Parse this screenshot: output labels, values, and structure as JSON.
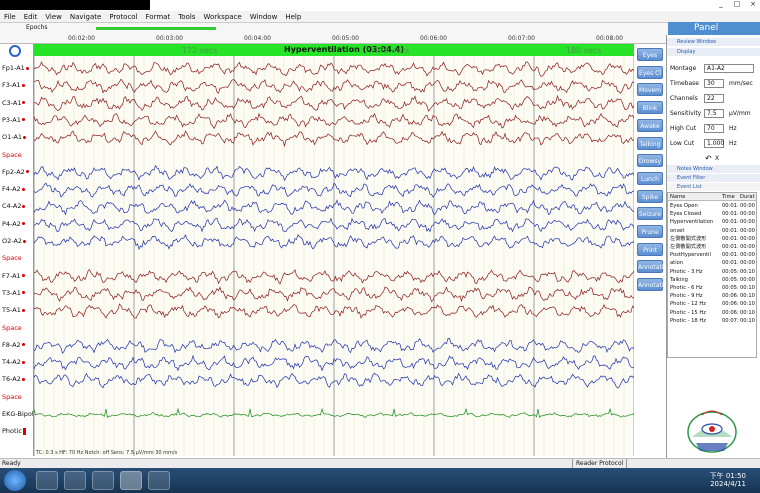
{
  "window": {
    "minimize": "_",
    "maximize": "□",
    "close": "×"
  },
  "menu": [
    "File",
    "Edit",
    "View",
    "Navigate",
    "Protocol",
    "Format",
    "Tools",
    "Workspace",
    "Window",
    "Help"
  ],
  "panel_tab": "Panel",
  "epochs_label": "Epochs",
  "timeline": [
    "00:02:00",
    "00:03:00",
    "00:04:00",
    "00:05:00",
    "00:06:00",
    "00:07:00",
    "00:08:00"
  ],
  "hv": {
    "title": "Hyperventilation (03:04.4)",
    "secs1": "172 secs",
    "secs2": "176 secs",
    "secs3": "180 secs"
  },
  "channels": [
    {
      "label": "Fp1-A1",
      "color": "#8b1a1a"
    },
    {
      "label": "F3-A1",
      "color": "#8b1a1a"
    },
    {
      "label": "C3-A1",
      "color": "#8b1a1a"
    },
    {
      "label": "P3-A1",
      "color": "#8b1a1a"
    },
    {
      "label": "O1-A1",
      "color": "#8b1a1a"
    },
    {
      "label": "Space",
      "color": "space"
    },
    {
      "label": "Fp2-A2",
      "color": "#1f2fa8"
    },
    {
      "label": "F4-A2",
      "color": "#1f2fa8"
    },
    {
      "label": "C4-A2",
      "color": "#1f2fa8"
    },
    {
      "label": "P4-A2",
      "color": "#1f2fa8"
    },
    {
      "label": "O2-A2",
      "color": "#1f2fa8"
    },
    {
      "label": "Space",
      "color": "space"
    },
    {
      "label": "F7-A1",
      "color": "#8b1a1a"
    },
    {
      "label": "T3-A1",
      "color": "#8b1a1a"
    },
    {
      "label": "T5-A1",
      "color": "#8b1a1a"
    },
    {
      "label": "Space",
      "color": "space"
    },
    {
      "label": "F8-A2",
      "color": "#1f2fa8"
    },
    {
      "label": "T4-A2",
      "color": "#1f2fa8"
    },
    {
      "label": "T6-A2",
      "color": "#1f2fa8"
    },
    {
      "label": "Space",
      "color": "space"
    },
    {
      "label": "EKG-Bipole",
      "color": "#1a8a1a"
    },
    {
      "label": "Photic",
      "color": "photic"
    }
  ],
  "buttons": [
    "Eyes Op",
    "Eyes Cl",
    "Movem",
    "Blink",
    "Awake",
    "Talking",
    "Drowsy",
    "Lunch",
    "Spike",
    "Seizure",
    "Prune",
    "Print",
    "Annotati",
    "Annotati"
  ],
  "panel": {
    "review_header": "Review Window",
    "display_header": "Display",
    "montage_label": "Montage",
    "montage_value": "A1-A2",
    "timebase_label": "Timebase",
    "timebase_value": "30",
    "timebase_unit": "mm/sec",
    "channels_label": "Channels",
    "channels_value": "22",
    "sensitivity_label": "Sensitivity",
    "sensitivity_value": "7.5",
    "sensitivity_unit": "µV/mm",
    "highcut_label": "High Cut",
    "highcut_value": "70",
    "highcut_unit": "Hz",
    "lowcut_label": "Low Cut",
    "lowcut_value": "1.000",
    "lowcut_unit": "Hz",
    "undo": "↶",
    "x": "X",
    "notes_header": "Notes Window",
    "events_header": "Event Filter",
    "events_sub": "Event List",
    "events_cols": [
      "Name",
      "Time",
      "Durat"
    ],
    "events": [
      [
        "Eyes Open",
        "00:01:",
        "00:00"
      ],
      [
        "Eyes Closed",
        "00:01:",
        "00:00"
      ],
      [
        "Hyperventilation",
        "00:01:",
        "00:00"
      ],
      [
        "onset",
        "00:01:",
        "00:00"
      ],
      [
        "左側散開式波形",
        "00:01:",
        "00:00"
      ],
      [
        "左側散開式波形",
        "00:01:",
        "00:00"
      ],
      [
        "PostHyperventil",
        "00:01:",
        "00:00"
      ],
      [
        "ation",
        "00:01:",
        "00:00"
      ],
      [
        "Photic - 3 Hz",
        "00:05:",
        "00:10"
      ],
      [
        "Talking",
        "00:05:",
        "00:00"
      ],
      [
        "Photic - 6 Hz",
        "00:05:",
        "00:10"
      ],
      [
        "Photic - 9 Hz",
        "00:06:",
        "00:10"
      ],
      [
        "Photic - 12 Hz",
        "00:06:",
        "00:10"
      ],
      [
        "Photic - 15 Hz",
        "00:06:",
        "00:10"
      ],
      [
        "Photic - 18 Hz",
        "00:07:",
        "00:10"
      ]
    ]
  },
  "status": {
    "left": "Ready",
    "middle": "Reader Protocol"
  },
  "footer_info": "TC: 0.3 s  HF: 70 Hz  Notch: off  Sens: 7.5 µV/mm  30 mm/s",
  "clock": {
    "time": "下午 01:50",
    "date": "2024/4/11"
  }
}
